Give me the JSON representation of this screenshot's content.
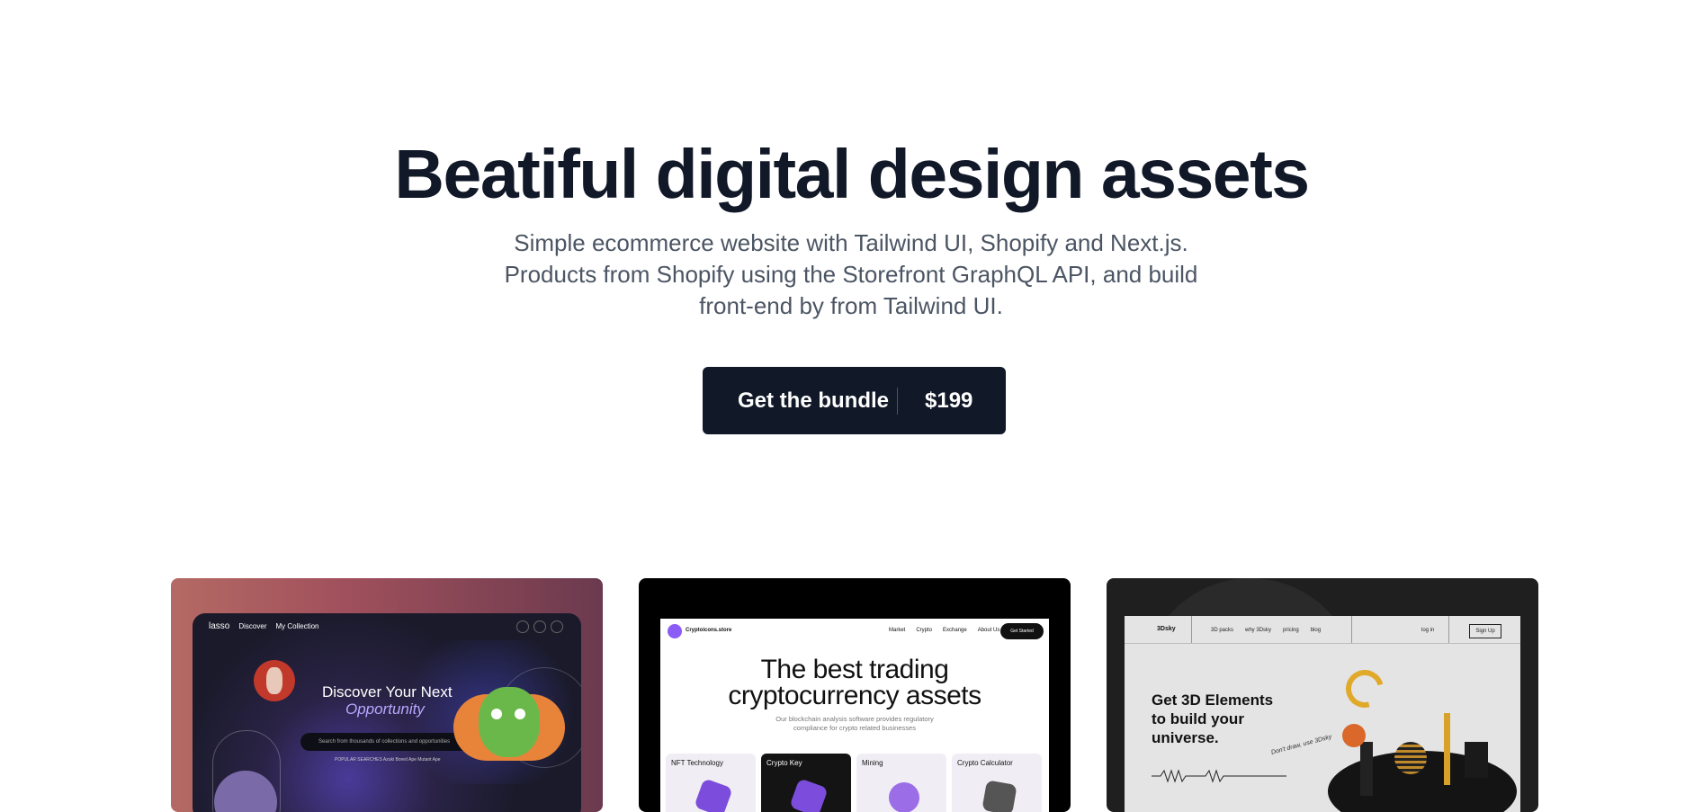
{
  "hero": {
    "title": "Beatiful digital design assets",
    "subtitle_line1": "Simple ecommerce website with Tailwind UI, Shopify and Next.js.",
    "subtitle_line2": "Products from Shopify using the Storefront GraphQL API, and build",
    "subtitle_line3": "front-end by from Tailwind UI.",
    "cta_label": "Get the bundle",
    "cta_price": "$199"
  },
  "cards": {
    "lasso": {
      "logo": "lasso",
      "nav": [
        "Discover",
        "My Collection"
      ],
      "title": "Discover Your Next",
      "title_accent": "Opportunity",
      "search_placeholder": "Search from thousands of collections and opportunities",
      "tags": "POPULAR SEARCHES   Azuki   Bored Ape   Mutant Ape"
    },
    "crypto": {
      "brand": "Cryptoicons.store",
      "nav": [
        "Market",
        "Crypto",
        "Exchange",
        "About Us"
      ],
      "cta": "Get Started",
      "headline_1": "The best trading",
      "headline_2": "cryptocurrency assets",
      "desc_1": "Our blockchain analysis software provides regulatory",
      "desc_2": "compliance for crypto related businesses",
      "tiles": [
        "NFT Technology",
        "Crypto Key",
        "Mining",
        "Crypto Calculator"
      ]
    },
    "threed": {
      "brand": "3Dsky",
      "nav": [
        "3D packs",
        "why 3Dsky",
        "pricing",
        "blog"
      ],
      "login": "log in",
      "signup": "Sign Up",
      "headline_1": "Get 3D Elements",
      "headline_2": "to build your",
      "headline_3": "universe.",
      "note": "Don't draw, use 3Dsky"
    }
  },
  "colors": {
    "ink": "#111827",
    "muted": "#4b5563",
    "accent_purple": "#8b5cf6",
    "gold": "#e0a92a"
  }
}
